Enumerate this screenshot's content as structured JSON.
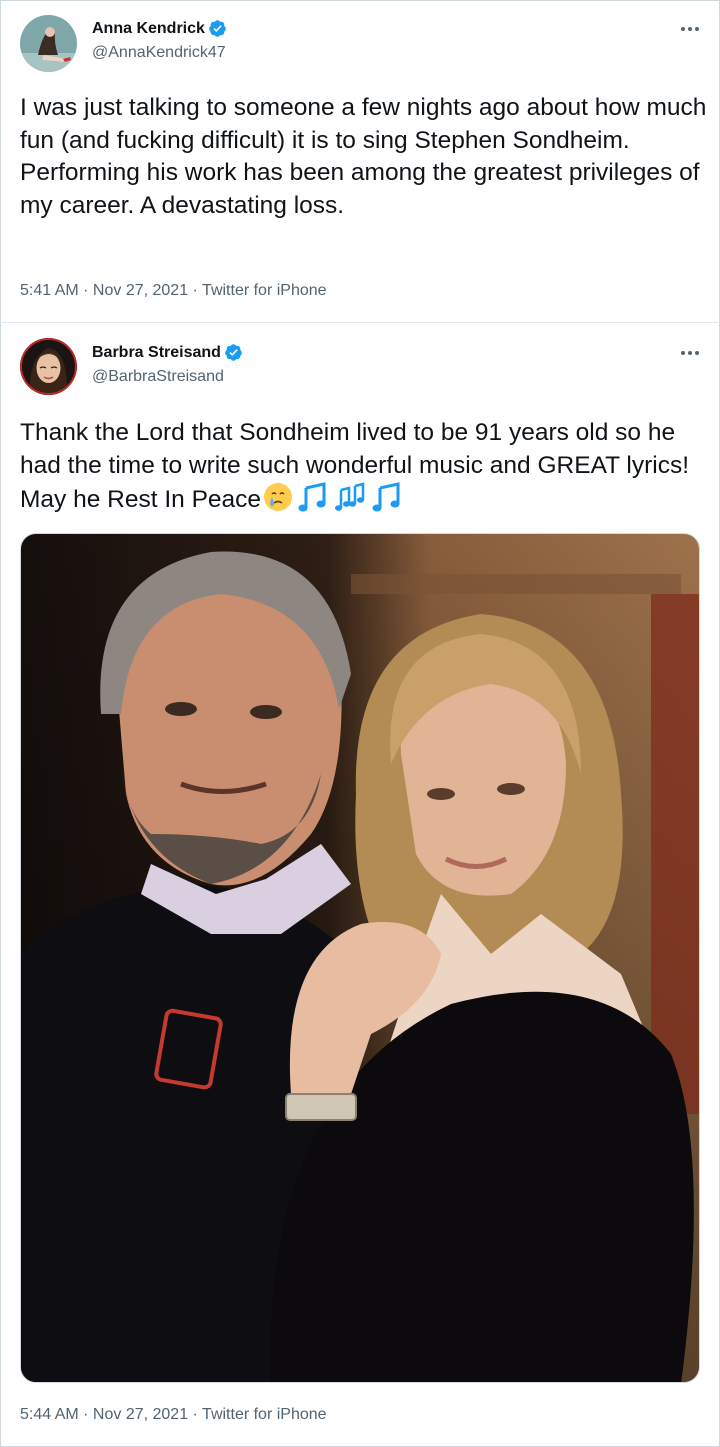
{
  "tweets": [
    {
      "name": "Anna Kendrick",
      "handle": "@AnnaKendrick47",
      "text": "I was just talking to someone a few nights ago about how much fun (and fucking difficult) it is to sing Stephen Sondheim. Performing his work has been among the greatest privileges of my career. A devastating loss.",
      "time": "5:41 AM",
      "date": "Nov 27, 2021",
      "source": "Twitter for iPhone",
      "verified": true,
      "avatar_icon": "profile-photo-woman"
    },
    {
      "name": "Barbra Streisand",
      "handle": "@BarbraStreisand",
      "text": "Thank the Lord that Sondheim lived to be 91 years old so he had the time to write such wonderful music and GREAT lyrics!  May he Rest In Peace",
      "emojis": [
        "crying-face-emoji",
        "musical-note-emoji",
        "musical-notes-emoji",
        "musical-note-emoji"
      ],
      "time": "5:44 AM",
      "date": "Nov 27, 2021",
      "source": "Twitter for iPhone",
      "verified": true,
      "avatar_icon": "profile-illustration-woman",
      "media": "photo-man-and-woman-posing"
    }
  ],
  "separator": " · ",
  "colors": {
    "verified_blue": "#1d9bf0",
    "secondary_text": "#536471",
    "primary_text": "#0f1419",
    "emoji_note_blue": "#1d9bf0"
  }
}
